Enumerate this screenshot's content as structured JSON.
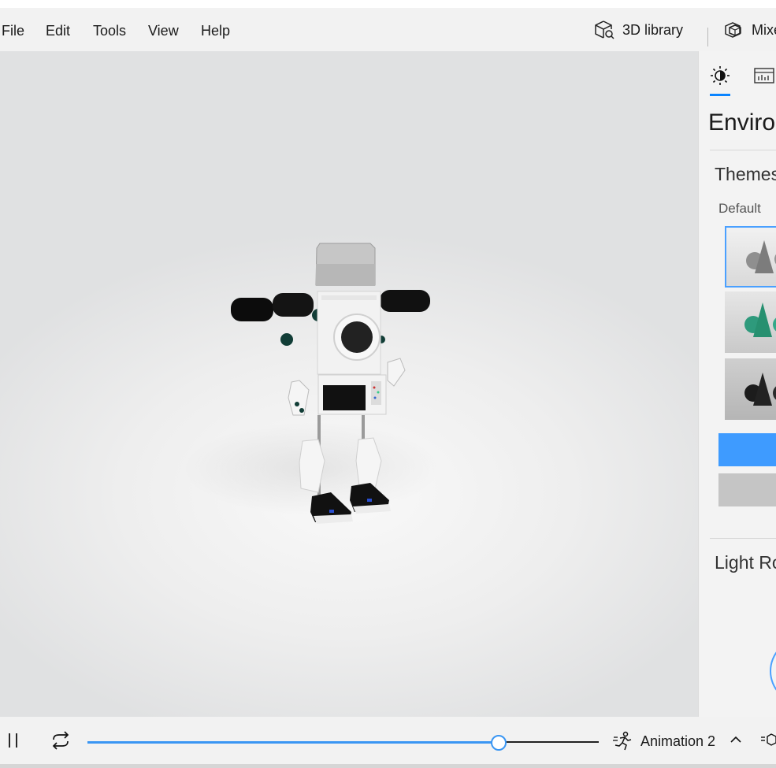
{
  "menu": {
    "items": [
      "File",
      "Edit",
      "Tools",
      "View",
      "Help"
    ],
    "library_label": "3D library",
    "mixed_reality_label": "Mixe"
  },
  "panel": {
    "title": "Environ",
    "themes_heading": "Themes",
    "themes_subhead": "Default",
    "light_heading": "Light Ro"
  },
  "bottom": {
    "animation_label": "Animation 2",
    "progress": 0.805
  },
  "colors": {
    "accent": "#3a96f3",
    "apply_button": "#3e9bff",
    "secondary_button": "#c5c5c5",
    "teal_theme": "#2e9a7c"
  },
  "icons": {
    "library": "cube-search-icon",
    "mixed_reality": "mixed-reality-icon",
    "environment_tab": "sun-icon",
    "stats_tab": "stats-grid-icon",
    "pause": "pause-icon",
    "loop": "loop-icon",
    "animation": "running-figure-icon",
    "expand": "chevron-up-icon",
    "overflow": "list-cube-icon"
  }
}
